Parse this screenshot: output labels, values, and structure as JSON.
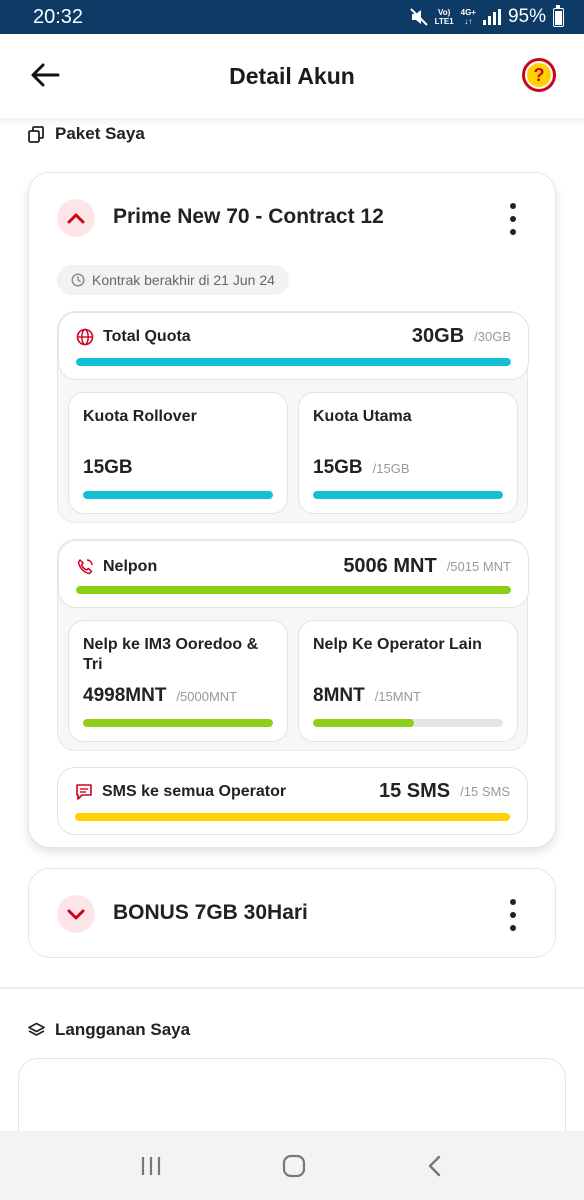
{
  "status_bar": {
    "time": "20:32",
    "volte_top": "Vo)",
    "volte_bottom": "LTE1",
    "network_top": "4G+",
    "network_bottom": "↓↑",
    "battery": "95%"
  },
  "header": {
    "title": "Detail Akun",
    "help_icon": "?"
  },
  "paket_section": {
    "title": "Paket Saya",
    "packages": [
      {
        "name": "Prime New 70 - Contract 12",
        "expanded": true,
        "contract_text": "Kontrak berakhir di 21 Jun 24",
        "groups": {
          "quota": {
            "label": "Total Quota",
            "value": "30GB",
            "max": "/30GB",
            "fill": 1.0,
            "items": [
              {
                "name": "Kuota Rollover",
                "value": "15GB",
                "max": "",
                "fill": 1.0
              },
              {
                "name": "Kuota Utama",
                "value": "15GB",
                "max": "/15GB",
                "fill": 1.0
              }
            ]
          },
          "call": {
            "label": "Nelpon",
            "value": "5006 MNT",
            "max": "/5015 MNT",
            "fill": 1.0,
            "items": [
              {
                "name": "Nelp ke IM3 Ooredoo & Tri",
                "value": "4998MNT",
                "max": "/5000MNT",
                "fill": 1.0
              },
              {
                "name": "Nelp Ke Operator Lain",
                "value": "8MNT",
                "max": "/15MNT",
                "fill": 0.53
              }
            ]
          },
          "sms": {
            "label": "SMS ke semua Operator",
            "value": "15 SMS",
            "max": "/15 SMS",
            "fill": 1.0
          }
        }
      },
      {
        "name": "BONUS 7GB 30Hari",
        "expanded": false
      }
    ]
  },
  "langganan_section": {
    "title": "Langganan Saya"
  },
  "colors": {
    "quota": "#12bfd3",
    "call": "#8ccf16",
    "sms": "#ffd100",
    "accent": "#d0021b",
    "status_bar": "#0d3b66"
  }
}
